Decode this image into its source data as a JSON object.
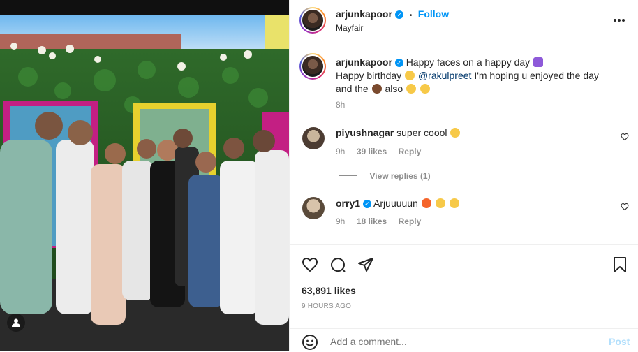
{
  "post": {
    "username": "arjunkapoor",
    "follow_label": "Follow",
    "separator": "•",
    "location": "Mayfair",
    "more_icon": "more-horizontal-icon"
  },
  "caption": {
    "username": "arjunkapoor",
    "line1": "Happy faces on a happy day",
    "line2_prefix": "Happy birthday",
    "mention": "@rakulpreet",
    "line2_suffix": "I'm hoping u enjoyed the day",
    "line3_prefix": "and the",
    "line3_suffix": "also",
    "time": "8h"
  },
  "comments": [
    {
      "username": "piyushnagar",
      "text": "super coool",
      "time": "9h",
      "likes": "39 likes",
      "reply": "Reply",
      "view_replies": "View replies (1)"
    },
    {
      "username": "orry1",
      "text": "Arjuuuuun",
      "time": "9h",
      "likes": "18 likes",
      "reply": "Reply"
    }
  ],
  "actions": {
    "likes": "63,891 likes",
    "timestamp": "9 HOURS AGO"
  },
  "add_comment": {
    "placeholder": "Add a comment...",
    "post_label": "Post"
  },
  "colors": {
    "accent": "#0095f6",
    "muted": "#8e8e8e",
    "verified": "#0095f6"
  }
}
